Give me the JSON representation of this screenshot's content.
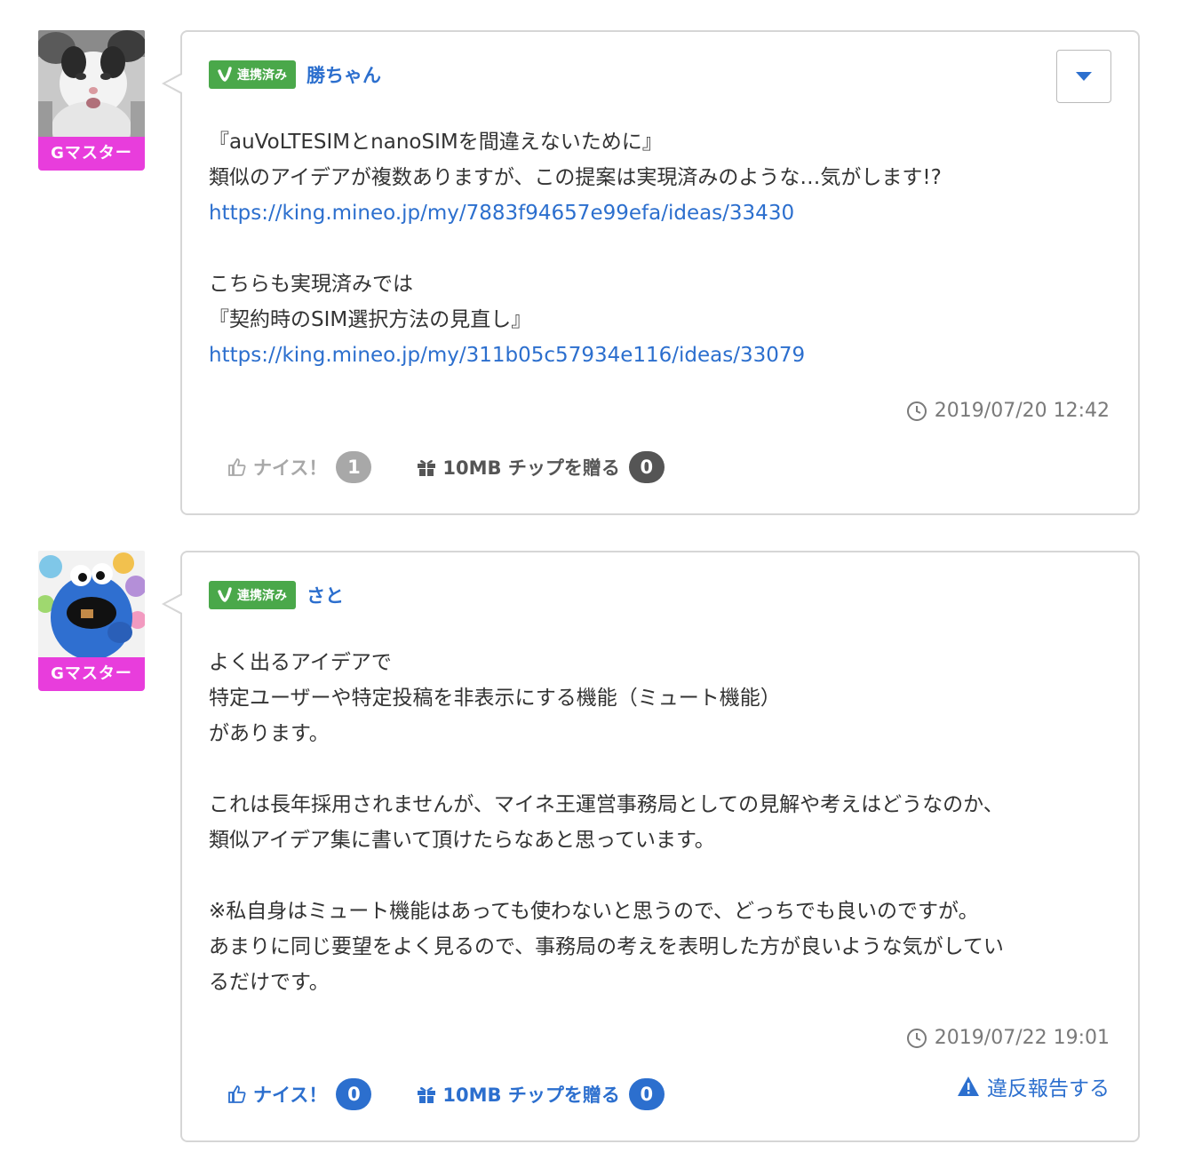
{
  "comments": [
    {
      "rank_badge": "Gマスター",
      "linked_badge": "連携済み",
      "user_name": "勝ちゃん",
      "body": {
        "line1": "『auVoLTESIMとnanoSIMを間違えないために』",
        "line2": "類似のアイデアが複数ありますが、この提案は実現済みのような…気がします!?",
        "link1": "https://king.mineo.jp/my/7883f94657e99efa/ideas/33430",
        "line3": "こちらも実現済みでは",
        "line4": "『契約時のSIM選択方法の見直し』",
        "link2": "https://king.mineo.jp/my/311b05c57934e116/ideas/33079"
      },
      "timestamp": "2019/07/20 12:42",
      "nice_label": "ナイス！",
      "nice_count": "1",
      "gift_label": "10MB チップを贈る",
      "gift_count": "0"
    },
    {
      "rank_badge": "Gマスター",
      "linked_badge": "連携済み",
      "user_name": "さと",
      "body": {
        "line1": "よく出るアイデアで",
        "line2": "特定ユーザーや特定投稿を非表示にする機能（ミュート機能）",
        "line3": "があります。",
        "line4": "これは長年採用されませんが、マイネ王運営事務局としての見解や考えはどうなのか、",
        "line5": "類似アイデア集に書いて頂けたらなあと思っています。",
        "line6": "※私自身はミュート機能はあっても使わないと思うので、どっちでも良いのですが。",
        "line7": "あまりに同じ要望をよく見るので、事務局の考えを表明した方が良いような気がしてい",
        "line8": "るだけです。"
      },
      "timestamp": "2019/07/22 19:01",
      "nice_label": "ナイス！",
      "nice_count": "0",
      "gift_label": "10MB チップを贈る",
      "gift_count": "0",
      "report_label": "違反報告する"
    }
  ],
  "colors": {
    "link": "#2c6fce",
    "rank_badge": "#e83ddc",
    "linked_badge": "#4aa84a",
    "border": "#d6d6d6"
  },
  "icons": [
    "chevron-down-icon",
    "check-icon",
    "clock-icon",
    "thumbs-up-icon",
    "gift-icon",
    "warning-icon"
  ]
}
